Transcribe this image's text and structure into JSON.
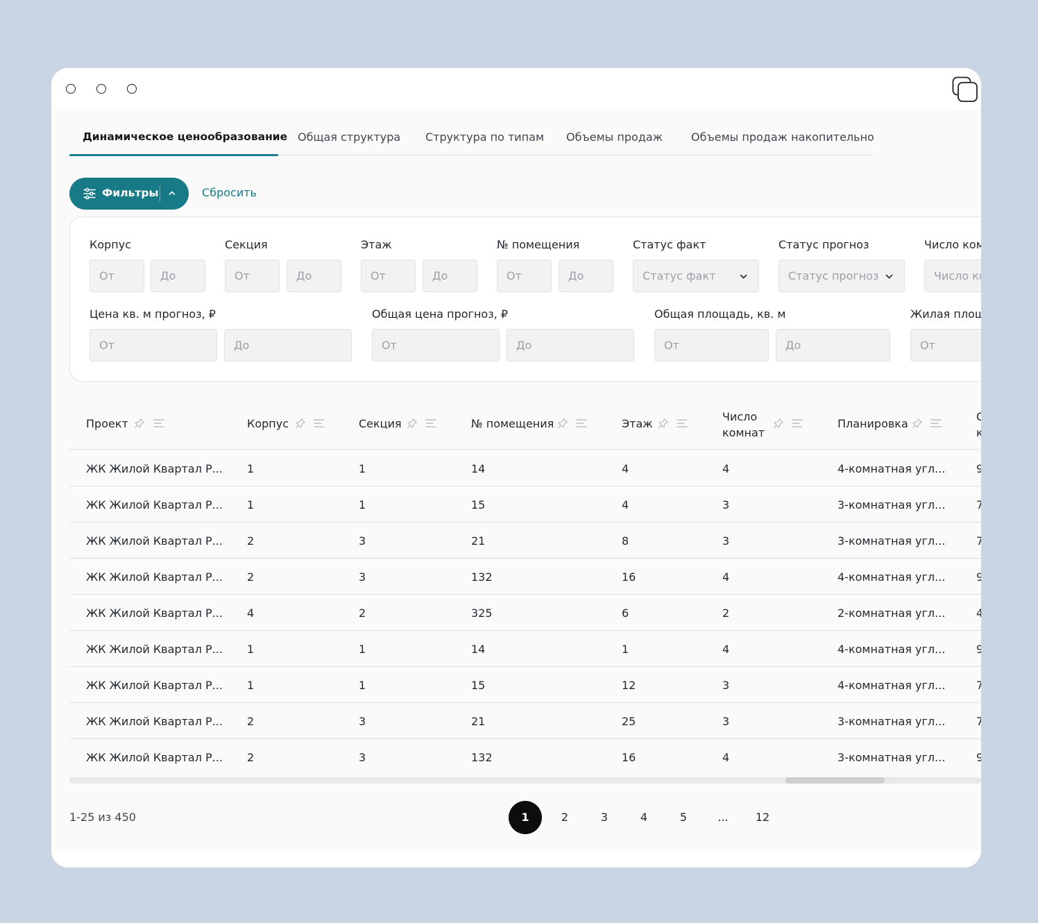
{
  "tabs": [
    {
      "label": "Динамическое ценообразование"
    },
    {
      "label": "Общая структура"
    },
    {
      "label": "Структура по типам"
    },
    {
      "label": "Объемы продаж"
    },
    {
      "label": "Объемы продаж накопительно"
    }
  ],
  "toolbar": {
    "filters_label": "Фильтры",
    "reset_label": "Сбросить"
  },
  "filters": {
    "korpus": {
      "label": "Корпус",
      "from": "От",
      "to": "До"
    },
    "sektsiya": {
      "label": "Секция",
      "from": "От",
      "to": "До"
    },
    "etazh": {
      "label": "Этаж",
      "from": "От",
      "to": "До"
    },
    "nomer": {
      "label": "№ помещения",
      "from": "От",
      "to": "До"
    },
    "status_fact": {
      "label": "Статус факт",
      "placeholder": "Статус факт"
    },
    "status_prognoz": {
      "label": "Статус прогноз",
      "placeholder": "Статус прогноз"
    },
    "rooms": {
      "label": "Число ком",
      "placeholder": "Число ко"
    },
    "price_sqm": {
      "label": "Цена кв. м прогноз, ₽",
      "from": "От",
      "to": "До"
    },
    "price_total": {
      "label": "Общая цена прогноз, ₽",
      "from": "От",
      "to": "До"
    },
    "area_total": {
      "label": "Общая площадь, кв. м",
      "from": "От",
      "to": "До"
    },
    "area_living": {
      "label": "Жилая площа",
      "from": "От"
    }
  },
  "table": {
    "columns": [
      "Проект",
      "Корпус",
      "Секция",
      "№ помещения",
      "Этаж",
      "Число",
      "комнат",
      "Планировка",
      "С",
      "к"
    ],
    "rows": [
      [
        "ЖК Жилой Квартал Р...",
        "1",
        "1",
        "14",
        "4",
        "4",
        "4-комнатная угл...",
        "9"
      ],
      [
        "ЖК Жилой Квартал Р...",
        "1",
        "1",
        "15",
        "4",
        "3",
        "3-комнатная угл...",
        "7"
      ],
      [
        "ЖК Жилой Квартал Р...",
        "2",
        "3",
        "21",
        "8",
        "3",
        "3-комнатная угл...",
        "7"
      ],
      [
        "ЖК Жилой Квартал Р...",
        "2",
        "3",
        "132",
        "16",
        "4",
        "4-комнатная угл...",
        "9"
      ],
      [
        "ЖК Жилой Квартал Р...",
        "4",
        "2",
        "325",
        "6",
        "2",
        "2-комнатная угл...",
        "4"
      ],
      [
        "ЖК Жилой Квартал Р...",
        "1",
        "1",
        "14",
        "1",
        "4",
        "4-комнатная угл...",
        "9"
      ],
      [
        "ЖК Жилой Квартал Р...",
        "1",
        "1",
        "15",
        "12",
        "3",
        "4-комнатная угл...",
        "7"
      ],
      [
        "ЖК Жилой Квартал Р...",
        "2",
        "3",
        "21",
        "25",
        "3",
        "3-комнатная угл...",
        "7"
      ],
      [
        "ЖК Жилой Квартал Р...",
        "2",
        "3",
        "132",
        "16",
        "4",
        "3-комнатная угл...",
        "9"
      ]
    ]
  },
  "pagination": {
    "range": "1-25 из 450",
    "pages": [
      "1",
      "2",
      "3",
      "4",
      "5",
      "...",
      "12"
    ],
    "current": "1"
  },
  "colors": {
    "accent": "#187a86",
    "active_page": "#0d0d0d",
    "background": "#c9d5e2"
  }
}
